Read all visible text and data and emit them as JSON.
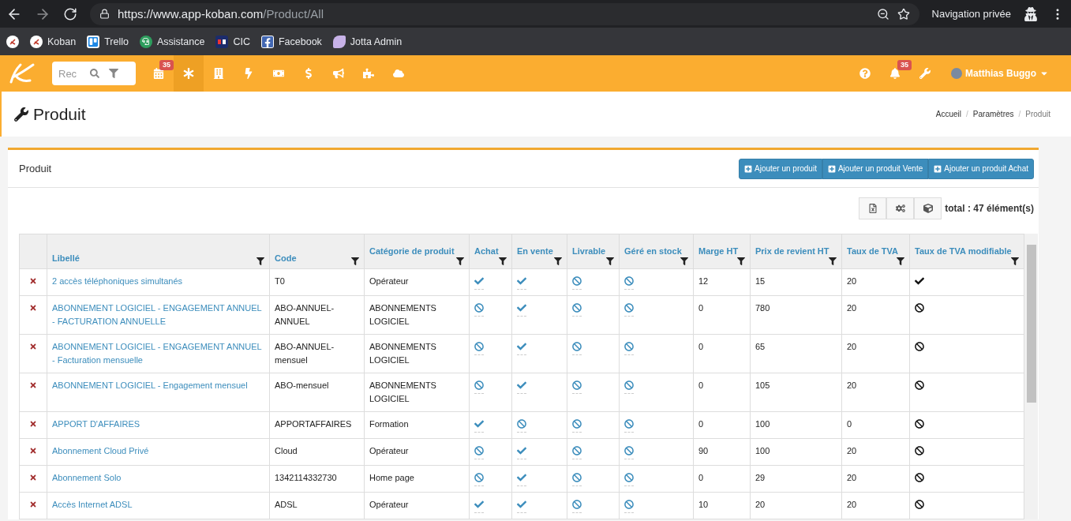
{
  "browser": {
    "url_host": "https://www.app-koban.com",
    "url_path": "/Product/All",
    "mode_label": "Navigation privée"
  },
  "bookmarks": [
    {
      "kind": "koban"
    },
    {
      "kind": "koban",
      "label": "Koban"
    },
    {
      "kind": "trello",
      "label": "Trello"
    },
    {
      "kind": "support",
      "label": "Assistance"
    },
    {
      "kind": "bank",
      "label": "CIC"
    },
    {
      "kind": "facebook",
      "label": "Facebook"
    },
    {
      "kind": "jotta",
      "label": "Jotta Admin"
    }
  ],
  "navbar": {
    "search": {
      "placeholder": "Rec"
    },
    "items": [
      {
        "kind": "calendar",
        "badge": "35",
        "selected": false
      },
      {
        "kind": "asterisk",
        "selected": true
      },
      {
        "kind": "building",
        "selected": false
      },
      {
        "kind": "bolt",
        "selected": false
      },
      {
        "kind": "money",
        "selected": false
      },
      {
        "kind": "dollar",
        "selected": false
      },
      {
        "kind": "bullhorn",
        "selected": false
      },
      {
        "kind": "puzzle",
        "selected": false
      },
      {
        "kind": "cloud",
        "selected": false
      }
    ],
    "right": [
      {
        "kind": "help"
      },
      {
        "kind": "bell",
        "badge": "35"
      },
      {
        "kind": "wrench"
      }
    ],
    "user": "Matthias Buggo"
  },
  "page": {
    "title": "Produit",
    "breadcrumb": [
      "Accueil",
      "Paramètres",
      "Produit"
    ],
    "breadcrumb_separator": "/"
  },
  "panel": {
    "title": "Produit",
    "buttons": [
      "Ajouter un produit",
      "Ajouter un produit Vente",
      "Ajouter un produit Achat"
    ],
    "tools": [
      {
        "kind": "excel"
      },
      {
        "kind": "cogs"
      },
      {
        "kind": "cube"
      }
    ],
    "total": "total : 47 élément(s)"
  },
  "table": {
    "columns": [
      "Libellé",
      "Code",
      "Catégorie de produit",
      "Achat",
      "En vente",
      "Livrable",
      "Géré en stock",
      "Marge HT",
      "Prix de revient HT",
      "Taux de TVA",
      "Taux de TVA modifiable"
    ],
    "rows": [
      {
        "label": "2 accès téléphoniques simultanés",
        "code": "T0",
        "category": "Opérateur",
        "achat": true,
        "en_vente": true,
        "livrable": false,
        "stock": false,
        "marge": "12",
        "prix": "15",
        "tva": "20",
        "tva_modifiable": true
      },
      {
        "label": "ABONNEMENT LOGICIEL - ENGAGEMENT ANNUEL - FACTURATION ANNUELLE",
        "code": "ABO-ANNUEL-ANNUEL",
        "category": "ABONNEMENTS LOGICIEL",
        "achat": false,
        "en_vente": true,
        "livrable": false,
        "stock": false,
        "marge": "0",
        "prix": "780",
        "tva": "20",
        "tva_modifiable": false
      },
      {
        "label": "ABONNEMENT LOGICIEL - ENGAGEMENT ANNUEL - Facturation mensuelle",
        "code": "ABO-ANNUEL-mensuel",
        "category": "ABONNEMENTS LOGICIEL",
        "achat": false,
        "en_vente": true,
        "livrable": false,
        "stock": false,
        "marge": "0",
        "prix": "65",
        "tva": "20",
        "tva_modifiable": false
      },
      {
        "label": "ABONNEMENT LOGICIEL - Engagement mensuel",
        "code": "ABO-mensuel",
        "category": "ABONNEMENTS LOGICIEL",
        "achat": false,
        "en_vente": true,
        "livrable": false,
        "stock": false,
        "marge": "0",
        "prix": "105",
        "tva": "20",
        "tva_modifiable": false
      },
      {
        "label": "APPORT D'AFFAIRES",
        "code": "APPORTAFFAIRES",
        "category": "Formation",
        "achat": true,
        "en_vente": false,
        "livrable": false,
        "stock": false,
        "marge": "0",
        "prix": "100",
        "tva": "0",
        "tva_modifiable": false
      },
      {
        "label": "Abonnement Cloud Privé",
        "code": "Cloud",
        "category": "Opérateur",
        "achat": false,
        "en_vente": true,
        "livrable": false,
        "stock": false,
        "marge": "90",
        "prix": "100",
        "tva": "20",
        "tva_modifiable": false
      },
      {
        "label": "Abonnement Solo",
        "code": "1342114332730",
        "category": "Home page",
        "achat": false,
        "en_vente": true,
        "livrable": false,
        "stock": false,
        "marge": "0",
        "prix": "29",
        "tva": "20",
        "tva_modifiable": false
      },
      {
        "label": "Accès Internet ADSL",
        "code": "ADSL",
        "category": "Opérateur",
        "achat": true,
        "en_vente": true,
        "livrable": false,
        "stock": false,
        "marge": "10",
        "prix": "20",
        "tva": "20",
        "tva_modifiable": false
      }
    ]
  }
}
